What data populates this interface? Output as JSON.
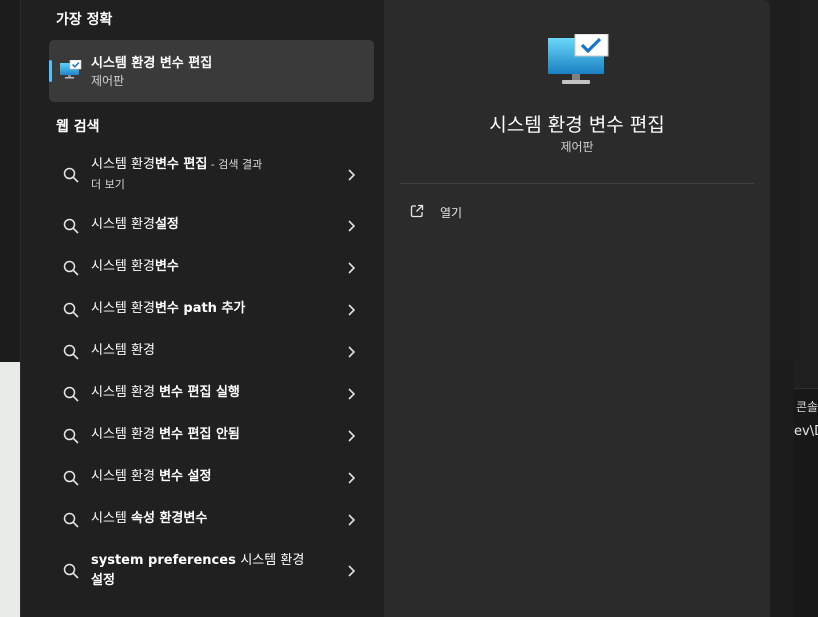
{
  "background": {
    "right_text_1": "콘솔",
    "right_text_2": "ev\\D"
  },
  "sections": {
    "best_match_title": "가장 정확",
    "web_search_title": "웹 검색"
  },
  "best_match": {
    "title": "시스템 환경 변수 편집",
    "subtitle": "제어판"
  },
  "web_results": [
    {
      "plain": "시스템 환경",
      "bold": "변수 편집",
      "suffix": " - 검색 결과",
      "line2": "더 보기"
    },
    {
      "plain": "시스템 환경",
      "bold": "설정",
      "suffix": "",
      "line2": ""
    },
    {
      "plain": "시스템 환경",
      "bold": "변수",
      "suffix": "",
      "line2": ""
    },
    {
      "plain": "시스템 환경",
      "bold": "변수 path 추가",
      "suffix": "",
      "line2": ""
    },
    {
      "plain": "시스템 환경",
      "bold": "",
      "suffix": "",
      "line2": ""
    },
    {
      "plain": "시스템 환경 ",
      "bold": "변수 편집 실행",
      "suffix": "",
      "line2": ""
    },
    {
      "plain": "시스템 환경 ",
      "bold": "변수 편집 안됨",
      "suffix": "",
      "line2": ""
    },
    {
      "plain": "시스템 환경 ",
      "bold": "변수 설정",
      "suffix": "",
      "line2": ""
    },
    {
      "plain": "시스템 ",
      "bold": "속성 환경변수",
      "suffix": "",
      "line2": ""
    },
    {
      "plain": "",
      "bold": "system preferences ",
      "after": "시스템 환경",
      "suffix": "",
      "line2": "설정"
    }
  ],
  "detail": {
    "title": "시스템 환경 변수 편집",
    "subtitle": "제어판",
    "open_label": "열기"
  },
  "colors": {
    "accent": "#4cc2ff",
    "panel_bg": "#202020",
    "detail_bg": "#2b2b2b"
  },
  "icons": {
    "app": "monitor-check-icon",
    "search": "search-icon",
    "chevron": "chevron-right-icon",
    "open": "open-external-icon"
  }
}
